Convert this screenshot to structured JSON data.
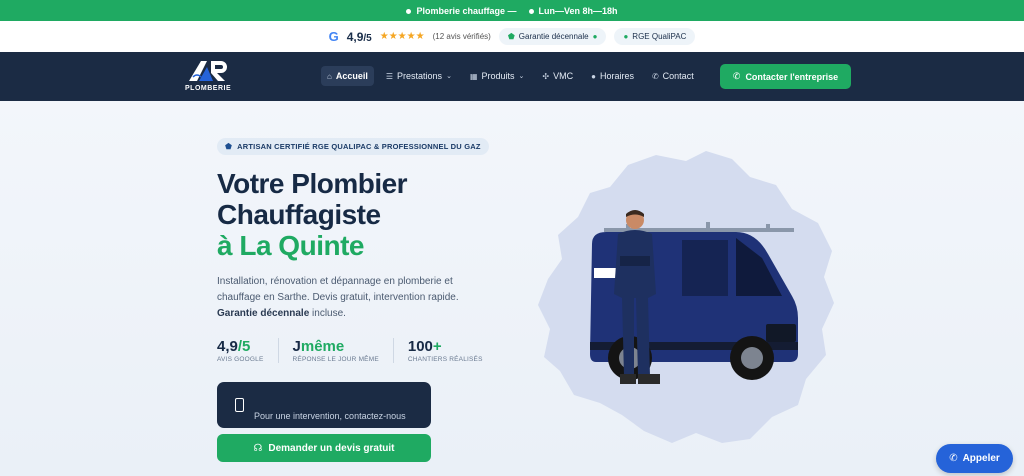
{
  "topbar": {
    "item1": "Plomberie chauffage —",
    "item2": "Lun—Ven 8h—18h"
  },
  "ratingbar": {
    "google_letter": "G",
    "score": "4,9",
    "score_max": "/5",
    "stars": "★★★★★",
    "reviews": "(12 avis vérifiés)",
    "pill1": "Garantie décennale",
    "pill2": "RGE QualiPAC"
  },
  "nav": {
    "brand": "PLOMBERIE",
    "links": [
      {
        "label": "Accueil",
        "icon": "home-icon"
      },
      {
        "label": "Prestations",
        "icon": "list-icon"
      },
      {
        "label": "Produits",
        "icon": "grid-icon"
      },
      {
        "label": "VMC",
        "icon": "fan-icon"
      },
      {
        "label": "Horaires",
        "icon": "clock-icon"
      },
      {
        "label": "Contact",
        "icon": "phone-icon"
      }
    ],
    "cta": "Contacter l'entreprise"
  },
  "hero": {
    "badge": "ARTISAN CERTIFIÉ RGE QUALIPAC & PROFESSIONNEL DU GAZ",
    "title_line1": "Votre Plombier",
    "title_line2": "Chauffagiste",
    "title_line3": "à La Quinte",
    "desc_part1": "Installation, rénovation et dépannage en plomberie et chauffage en Sarthe. Devis gratuit, intervention rapide.",
    "desc_bold": "Garantie décennale",
    "desc_part2": " incluse.",
    "stats": [
      {
        "value": "4,9",
        "value_green": "/5",
        "label": "AVIS GOOGLE"
      },
      {
        "value": "J",
        "value_green": "même",
        "label": "RÉPONSE LE JOUR MÊME"
      },
      {
        "value": "100",
        "value_green": "+",
        "label": "CHANTIERS RÉALISÉS"
      }
    ],
    "call_text": "Pour une intervention, contactez-nous",
    "devis_button": "Demander un devis gratuit"
  },
  "float_button": "Appeler",
  "colors": {
    "green": "#1faa62",
    "navy": "#1b2b44",
    "blue": "#2563d9"
  }
}
